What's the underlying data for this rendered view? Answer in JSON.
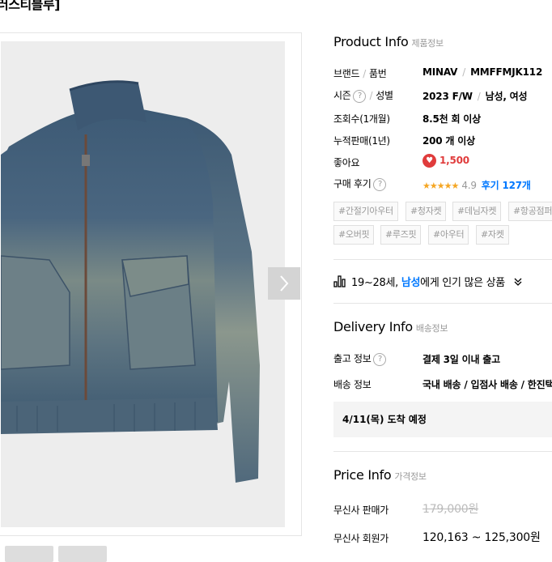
{
  "header": {
    "title_fragment": "러스티블루]"
  },
  "gallery": {
    "next_icon": "chevron-right-icon"
  },
  "product_info": {
    "title": "Product Info",
    "subtitle": "제품정보",
    "brand_label": "브랜드",
    "partno_label": "품번",
    "brand": "MINAV",
    "partno": "MMFFMJK112",
    "season_label": "시즌",
    "gender_label": "성별",
    "season": "2023 F/W",
    "gender": "남성, 여성",
    "views_label": "조회수(1개월)",
    "views": "8.5천 회 이상",
    "sales_label": "누적판매(1년)",
    "sales": "200 개 이상",
    "likes_label": "좋아요",
    "likes": "1,500",
    "review_label": "구매 후기",
    "stars": "★★★★★",
    "rating": "4.9",
    "review_count": "후기 127개",
    "help_glyph": "?"
  },
  "tags": [
    "#간절기아우터",
    "#청자켓",
    "#데님자켓",
    "#항공점퍼",
    "#오버핏",
    "#루즈핏",
    "#아우터",
    "#자켓"
  ],
  "popular": {
    "age": "19~28세,",
    "gender": "남성",
    "rest": "에게 인기 많은 상품"
  },
  "delivery_info": {
    "title": "Delivery Info",
    "subtitle": "배송정보",
    "ship_label": "출고 정보",
    "ship_value": "결제 3일 이내 출고",
    "method_label": "배송 정보",
    "method_value": "국내 배송 / 입점사 배송 / 한진택배",
    "arrival": "4/11(목) 도착 예정"
  },
  "price_info": {
    "title": "Price Info",
    "subtitle": "가격정보",
    "sale_label": "무신사 판매가",
    "sale_price": "179,000원",
    "member_label": "무신사 회원가",
    "member_price": "120,163 ~ 125,300원"
  },
  "colors": {
    "accent_blue": "#0078ff",
    "like_red": "#e03c3c",
    "star": "#f5a623"
  }
}
